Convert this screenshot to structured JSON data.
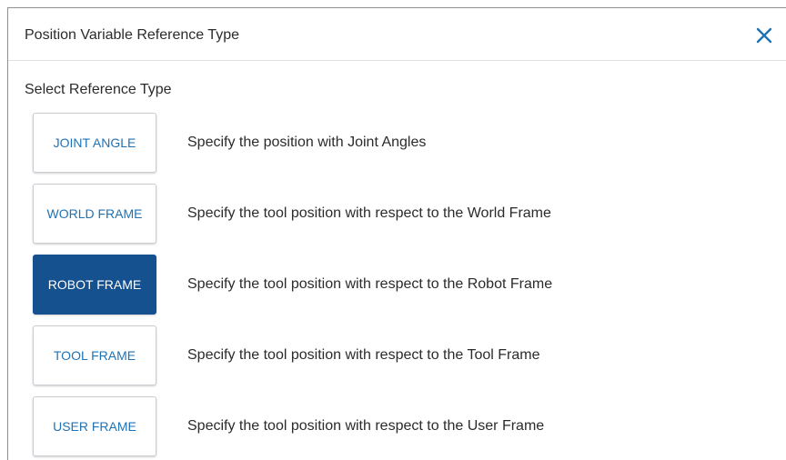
{
  "dialog": {
    "title": "Position Variable Reference Type",
    "close_icon": "close-icon",
    "subtitle": "Select Reference Type",
    "accent_color": "#1f72b5",
    "selected_color": "#15508f",
    "options": [
      {
        "label": "JOINT ANGLE",
        "description": "Specify the position with Joint Angles",
        "selected": false
      },
      {
        "label": "WORLD FRAME",
        "description": "Specify the tool position with respect to the World Frame",
        "selected": false
      },
      {
        "label": "ROBOT FRAME",
        "description": "Specify the tool position with respect to the Robot Frame",
        "selected": true
      },
      {
        "label": "TOOL FRAME",
        "description": "Specify the tool position with respect to the Tool Frame",
        "selected": false
      },
      {
        "label": "USER FRAME",
        "description": "Specify the tool position with respect to the User Frame",
        "selected": false
      }
    ]
  }
}
